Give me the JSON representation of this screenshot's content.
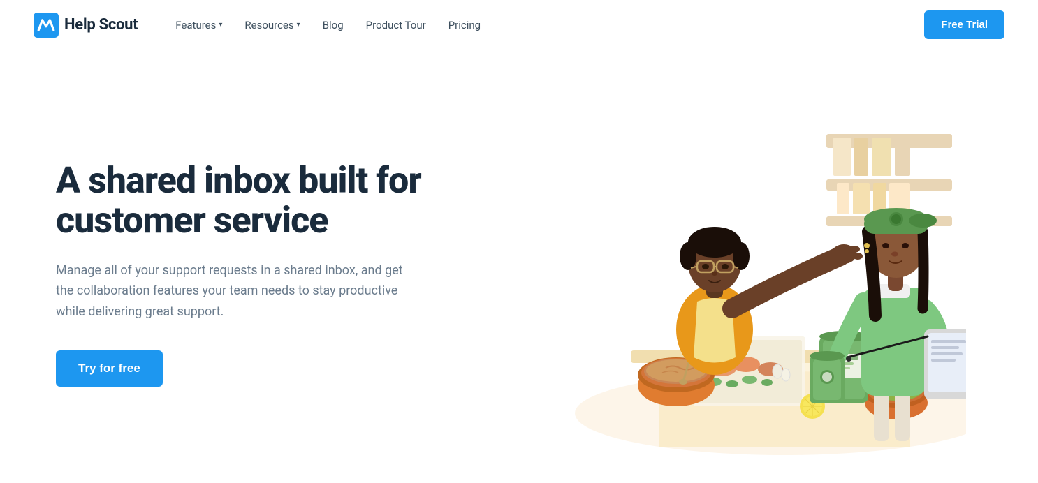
{
  "header": {
    "logo_text": "Help Scout",
    "nav_items": [
      {
        "label": "Features",
        "has_dropdown": true
      },
      {
        "label": "Resources",
        "has_dropdown": true
      },
      {
        "label": "Blog",
        "has_dropdown": false
      },
      {
        "label": "Product Tour",
        "has_dropdown": false
      },
      {
        "label": "Pricing",
        "has_dropdown": false
      }
    ],
    "cta_label": "Free Trial"
  },
  "hero": {
    "title": "A shared inbox built for customer service",
    "subtitle": "Manage all of your support requests in a shared inbox, and get the collaboration features your team needs to stay productive while delivering great support.",
    "cta_label": "Try for free"
  },
  "colors": {
    "accent": "#1d97f0",
    "dark": "#1a2b3c",
    "muted": "#6b7c8d"
  }
}
